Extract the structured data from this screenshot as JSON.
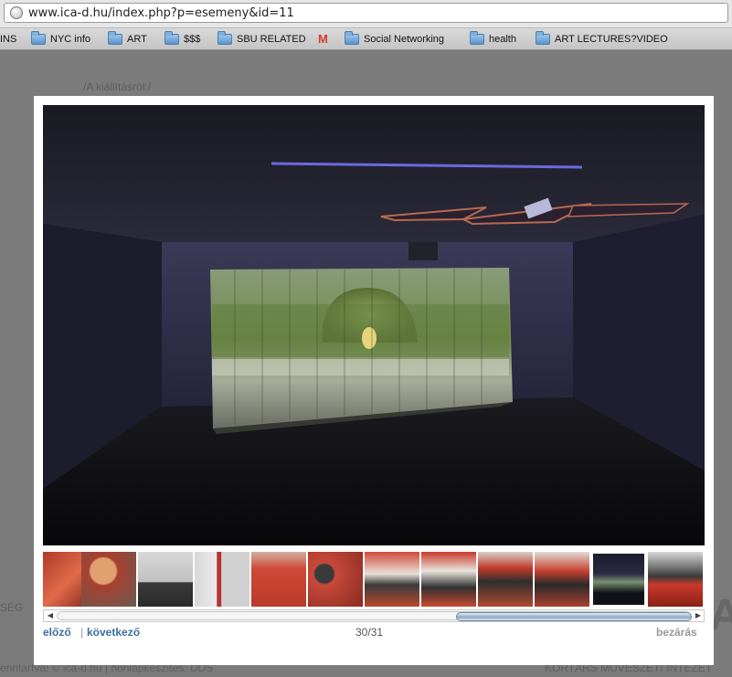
{
  "browser": {
    "url": "www.ica-d.hu/index.php?p=esemeny&id=11",
    "bookmarks": [
      {
        "label": "INS",
        "icon": "none"
      },
      {
        "label": "NYC info",
        "icon": "folder-icon"
      },
      {
        "label": "ART",
        "icon": "folder-icon"
      },
      {
        "label": "$$$",
        "icon": "folder-icon"
      },
      {
        "label": "SBU RELATED",
        "icon": "folder-icon"
      },
      {
        "label": "M",
        "icon": "gmail-icon"
      },
      {
        "label": "Social Networking",
        "icon": "folder-icon"
      },
      {
        "label": "health",
        "icon": "folder-icon"
      },
      {
        "label": "ART LECTURES?VIDEO",
        "icon": "folder-icon"
      }
    ]
  },
  "page": {
    "breadcrumb": "/A kiállításról:/",
    "left_fragment": "SÉG",
    "footer_left": "enntartva! © ica-d.hu | honlapkészítés: DDS",
    "footer_right": "KORTÁRS MŰVÉSZETI INTÉZET"
  },
  "lightbox": {
    "prev_label": "előző",
    "next_label": "következő",
    "counter": "30/31",
    "close_label": "bezárás",
    "current_index": 30,
    "total": 31,
    "scroll_position_percent": 63
  },
  "colors": {
    "link": "#3b6fa0",
    "overlay_bg": "#7b7b7b",
    "projection_green": "#6f8a4c"
  }
}
